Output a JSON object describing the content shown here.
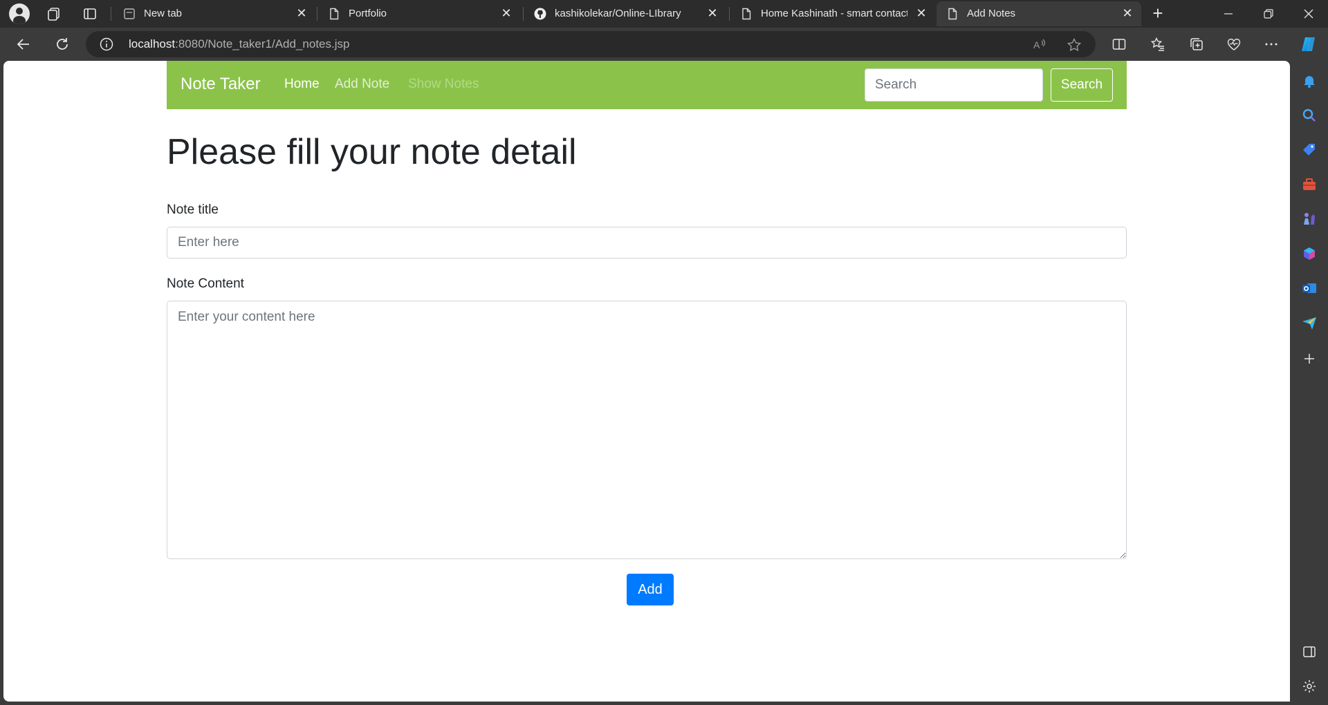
{
  "browser": {
    "tabs": [
      {
        "title": "New tab",
        "icon": "newtab-page-icon",
        "active": false
      },
      {
        "title": "Portfolio",
        "icon": "document-icon",
        "active": false
      },
      {
        "title": "kashikolekar/Online-LIbrary",
        "icon": "github-icon",
        "active": false
      },
      {
        "title": "Home Kashinath - smart contact",
        "icon": "document-icon",
        "active": false
      },
      {
        "title": "Add Notes",
        "icon": "document-icon",
        "active": true
      }
    ],
    "address": {
      "host": "localhost",
      "path": ":8080/Note_taker1/Add_notes.jsp"
    }
  },
  "navbar": {
    "brand": "Note Taker",
    "links": [
      "Home",
      "Add Note",
      "Show Notes"
    ],
    "search_placeholder": "Search",
    "search_button": "Search",
    "color": "#8bc34a"
  },
  "form": {
    "heading": "Please fill your note detail",
    "title_label": "Note title",
    "title_placeholder": "Enter here",
    "content_label": "Note Content",
    "content_placeholder": "Enter your content here",
    "submit_label": "Add",
    "submit_color": "#007bff"
  }
}
